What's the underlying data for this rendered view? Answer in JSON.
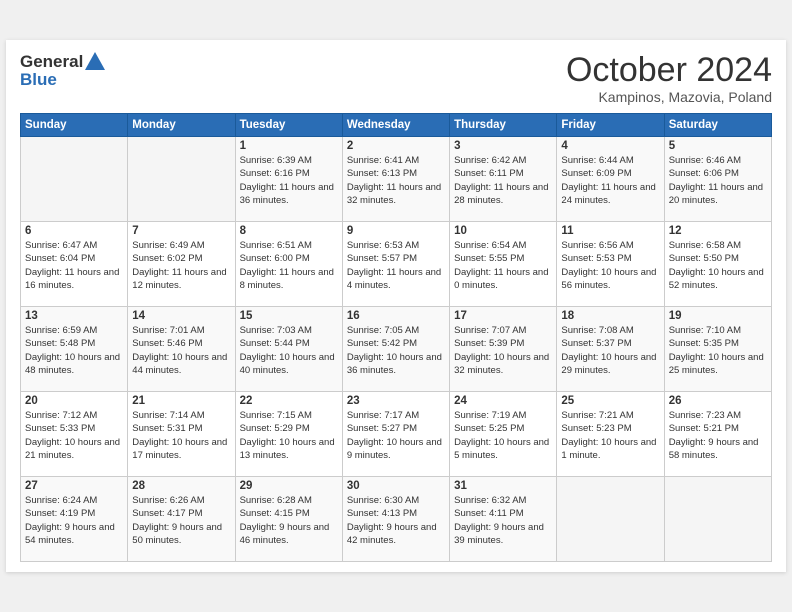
{
  "header": {
    "logo": {
      "general": "General",
      "blue": "Blue"
    },
    "title": "October 2024",
    "location": "Kampinos, Mazovia, Poland"
  },
  "weekdays": [
    "Sunday",
    "Monday",
    "Tuesday",
    "Wednesday",
    "Thursday",
    "Friday",
    "Saturday"
  ],
  "weeks": [
    [
      {
        "day": "",
        "sunrise": "",
        "sunset": "",
        "daylight": ""
      },
      {
        "day": "",
        "sunrise": "",
        "sunset": "",
        "daylight": ""
      },
      {
        "day": "1",
        "sunrise": "Sunrise: 6:39 AM",
        "sunset": "Sunset: 6:16 PM",
        "daylight": "Daylight: 11 hours and 36 minutes."
      },
      {
        "day": "2",
        "sunrise": "Sunrise: 6:41 AM",
        "sunset": "Sunset: 6:13 PM",
        "daylight": "Daylight: 11 hours and 32 minutes."
      },
      {
        "day": "3",
        "sunrise": "Sunrise: 6:42 AM",
        "sunset": "Sunset: 6:11 PM",
        "daylight": "Daylight: 11 hours and 28 minutes."
      },
      {
        "day": "4",
        "sunrise": "Sunrise: 6:44 AM",
        "sunset": "Sunset: 6:09 PM",
        "daylight": "Daylight: 11 hours and 24 minutes."
      },
      {
        "day": "5",
        "sunrise": "Sunrise: 6:46 AM",
        "sunset": "Sunset: 6:06 PM",
        "daylight": "Daylight: 11 hours and 20 minutes."
      }
    ],
    [
      {
        "day": "6",
        "sunrise": "Sunrise: 6:47 AM",
        "sunset": "Sunset: 6:04 PM",
        "daylight": "Daylight: 11 hours and 16 minutes."
      },
      {
        "day": "7",
        "sunrise": "Sunrise: 6:49 AM",
        "sunset": "Sunset: 6:02 PM",
        "daylight": "Daylight: 11 hours and 12 minutes."
      },
      {
        "day": "8",
        "sunrise": "Sunrise: 6:51 AM",
        "sunset": "Sunset: 6:00 PM",
        "daylight": "Daylight: 11 hours and 8 minutes."
      },
      {
        "day": "9",
        "sunrise": "Sunrise: 6:53 AM",
        "sunset": "Sunset: 5:57 PM",
        "daylight": "Daylight: 11 hours and 4 minutes."
      },
      {
        "day": "10",
        "sunrise": "Sunrise: 6:54 AM",
        "sunset": "Sunset: 5:55 PM",
        "daylight": "Daylight: 11 hours and 0 minutes."
      },
      {
        "day": "11",
        "sunrise": "Sunrise: 6:56 AM",
        "sunset": "Sunset: 5:53 PM",
        "daylight": "Daylight: 10 hours and 56 minutes."
      },
      {
        "day": "12",
        "sunrise": "Sunrise: 6:58 AM",
        "sunset": "Sunset: 5:50 PM",
        "daylight": "Daylight: 10 hours and 52 minutes."
      }
    ],
    [
      {
        "day": "13",
        "sunrise": "Sunrise: 6:59 AM",
        "sunset": "Sunset: 5:48 PM",
        "daylight": "Daylight: 10 hours and 48 minutes."
      },
      {
        "day": "14",
        "sunrise": "Sunrise: 7:01 AM",
        "sunset": "Sunset: 5:46 PM",
        "daylight": "Daylight: 10 hours and 44 minutes."
      },
      {
        "day": "15",
        "sunrise": "Sunrise: 7:03 AM",
        "sunset": "Sunset: 5:44 PM",
        "daylight": "Daylight: 10 hours and 40 minutes."
      },
      {
        "day": "16",
        "sunrise": "Sunrise: 7:05 AM",
        "sunset": "Sunset: 5:42 PM",
        "daylight": "Daylight: 10 hours and 36 minutes."
      },
      {
        "day": "17",
        "sunrise": "Sunrise: 7:07 AM",
        "sunset": "Sunset: 5:39 PM",
        "daylight": "Daylight: 10 hours and 32 minutes."
      },
      {
        "day": "18",
        "sunrise": "Sunrise: 7:08 AM",
        "sunset": "Sunset: 5:37 PM",
        "daylight": "Daylight: 10 hours and 29 minutes."
      },
      {
        "day": "19",
        "sunrise": "Sunrise: 7:10 AM",
        "sunset": "Sunset: 5:35 PM",
        "daylight": "Daylight: 10 hours and 25 minutes."
      }
    ],
    [
      {
        "day": "20",
        "sunrise": "Sunrise: 7:12 AM",
        "sunset": "Sunset: 5:33 PM",
        "daylight": "Daylight: 10 hours and 21 minutes."
      },
      {
        "day": "21",
        "sunrise": "Sunrise: 7:14 AM",
        "sunset": "Sunset: 5:31 PM",
        "daylight": "Daylight: 10 hours and 17 minutes."
      },
      {
        "day": "22",
        "sunrise": "Sunrise: 7:15 AM",
        "sunset": "Sunset: 5:29 PM",
        "daylight": "Daylight: 10 hours and 13 minutes."
      },
      {
        "day": "23",
        "sunrise": "Sunrise: 7:17 AM",
        "sunset": "Sunset: 5:27 PM",
        "daylight": "Daylight: 10 hours and 9 minutes."
      },
      {
        "day": "24",
        "sunrise": "Sunrise: 7:19 AM",
        "sunset": "Sunset: 5:25 PM",
        "daylight": "Daylight: 10 hours and 5 minutes."
      },
      {
        "day": "25",
        "sunrise": "Sunrise: 7:21 AM",
        "sunset": "Sunset: 5:23 PM",
        "daylight": "Daylight: 10 hours and 1 minute."
      },
      {
        "day": "26",
        "sunrise": "Sunrise: 7:23 AM",
        "sunset": "Sunset: 5:21 PM",
        "daylight": "Daylight: 9 hours and 58 minutes."
      }
    ],
    [
      {
        "day": "27",
        "sunrise": "Sunrise: 6:24 AM",
        "sunset": "Sunset: 4:19 PM",
        "daylight": "Daylight: 9 hours and 54 minutes."
      },
      {
        "day": "28",
        "sunrise": "Sunrise: 6:26 AM",
        "sunset": "Sunset: 4:17 PM",
        "daylight": "Daylight: 9 hours and 50 minutes."
      },
      {
        "day": "29",
        "sunrise": "Sunrise: 6:28 AM",
        "sunset": "Sunset: 4:15 PM",
        "daylight": "Daylight: 9 hours and 46 minutes."
      },
      {
        "day": "30",
        "sunrise": "Sunrise: 6:30 AM",
        "sunset": "Sunset: 4:13 PM",
        "daylight": "Daylight: 9 hours and 42 minutes."
      },
      {
        "day": "31",
        "sunrise": "Sunrise: 6:32 AM",
        "sunset": "Sunset: 4:11 PM",
        "daylight": "Daylight: 9 hours and 39 minutes."
      },
      {
        "day": "",
        "sunrise": "",
        "sunset": "",
        "daylight": ""
      },
      {
        "day": "",
        "sunrise": "",
        "sunset": "",
        "daylight": ""
      }
    ]
  ]
}
